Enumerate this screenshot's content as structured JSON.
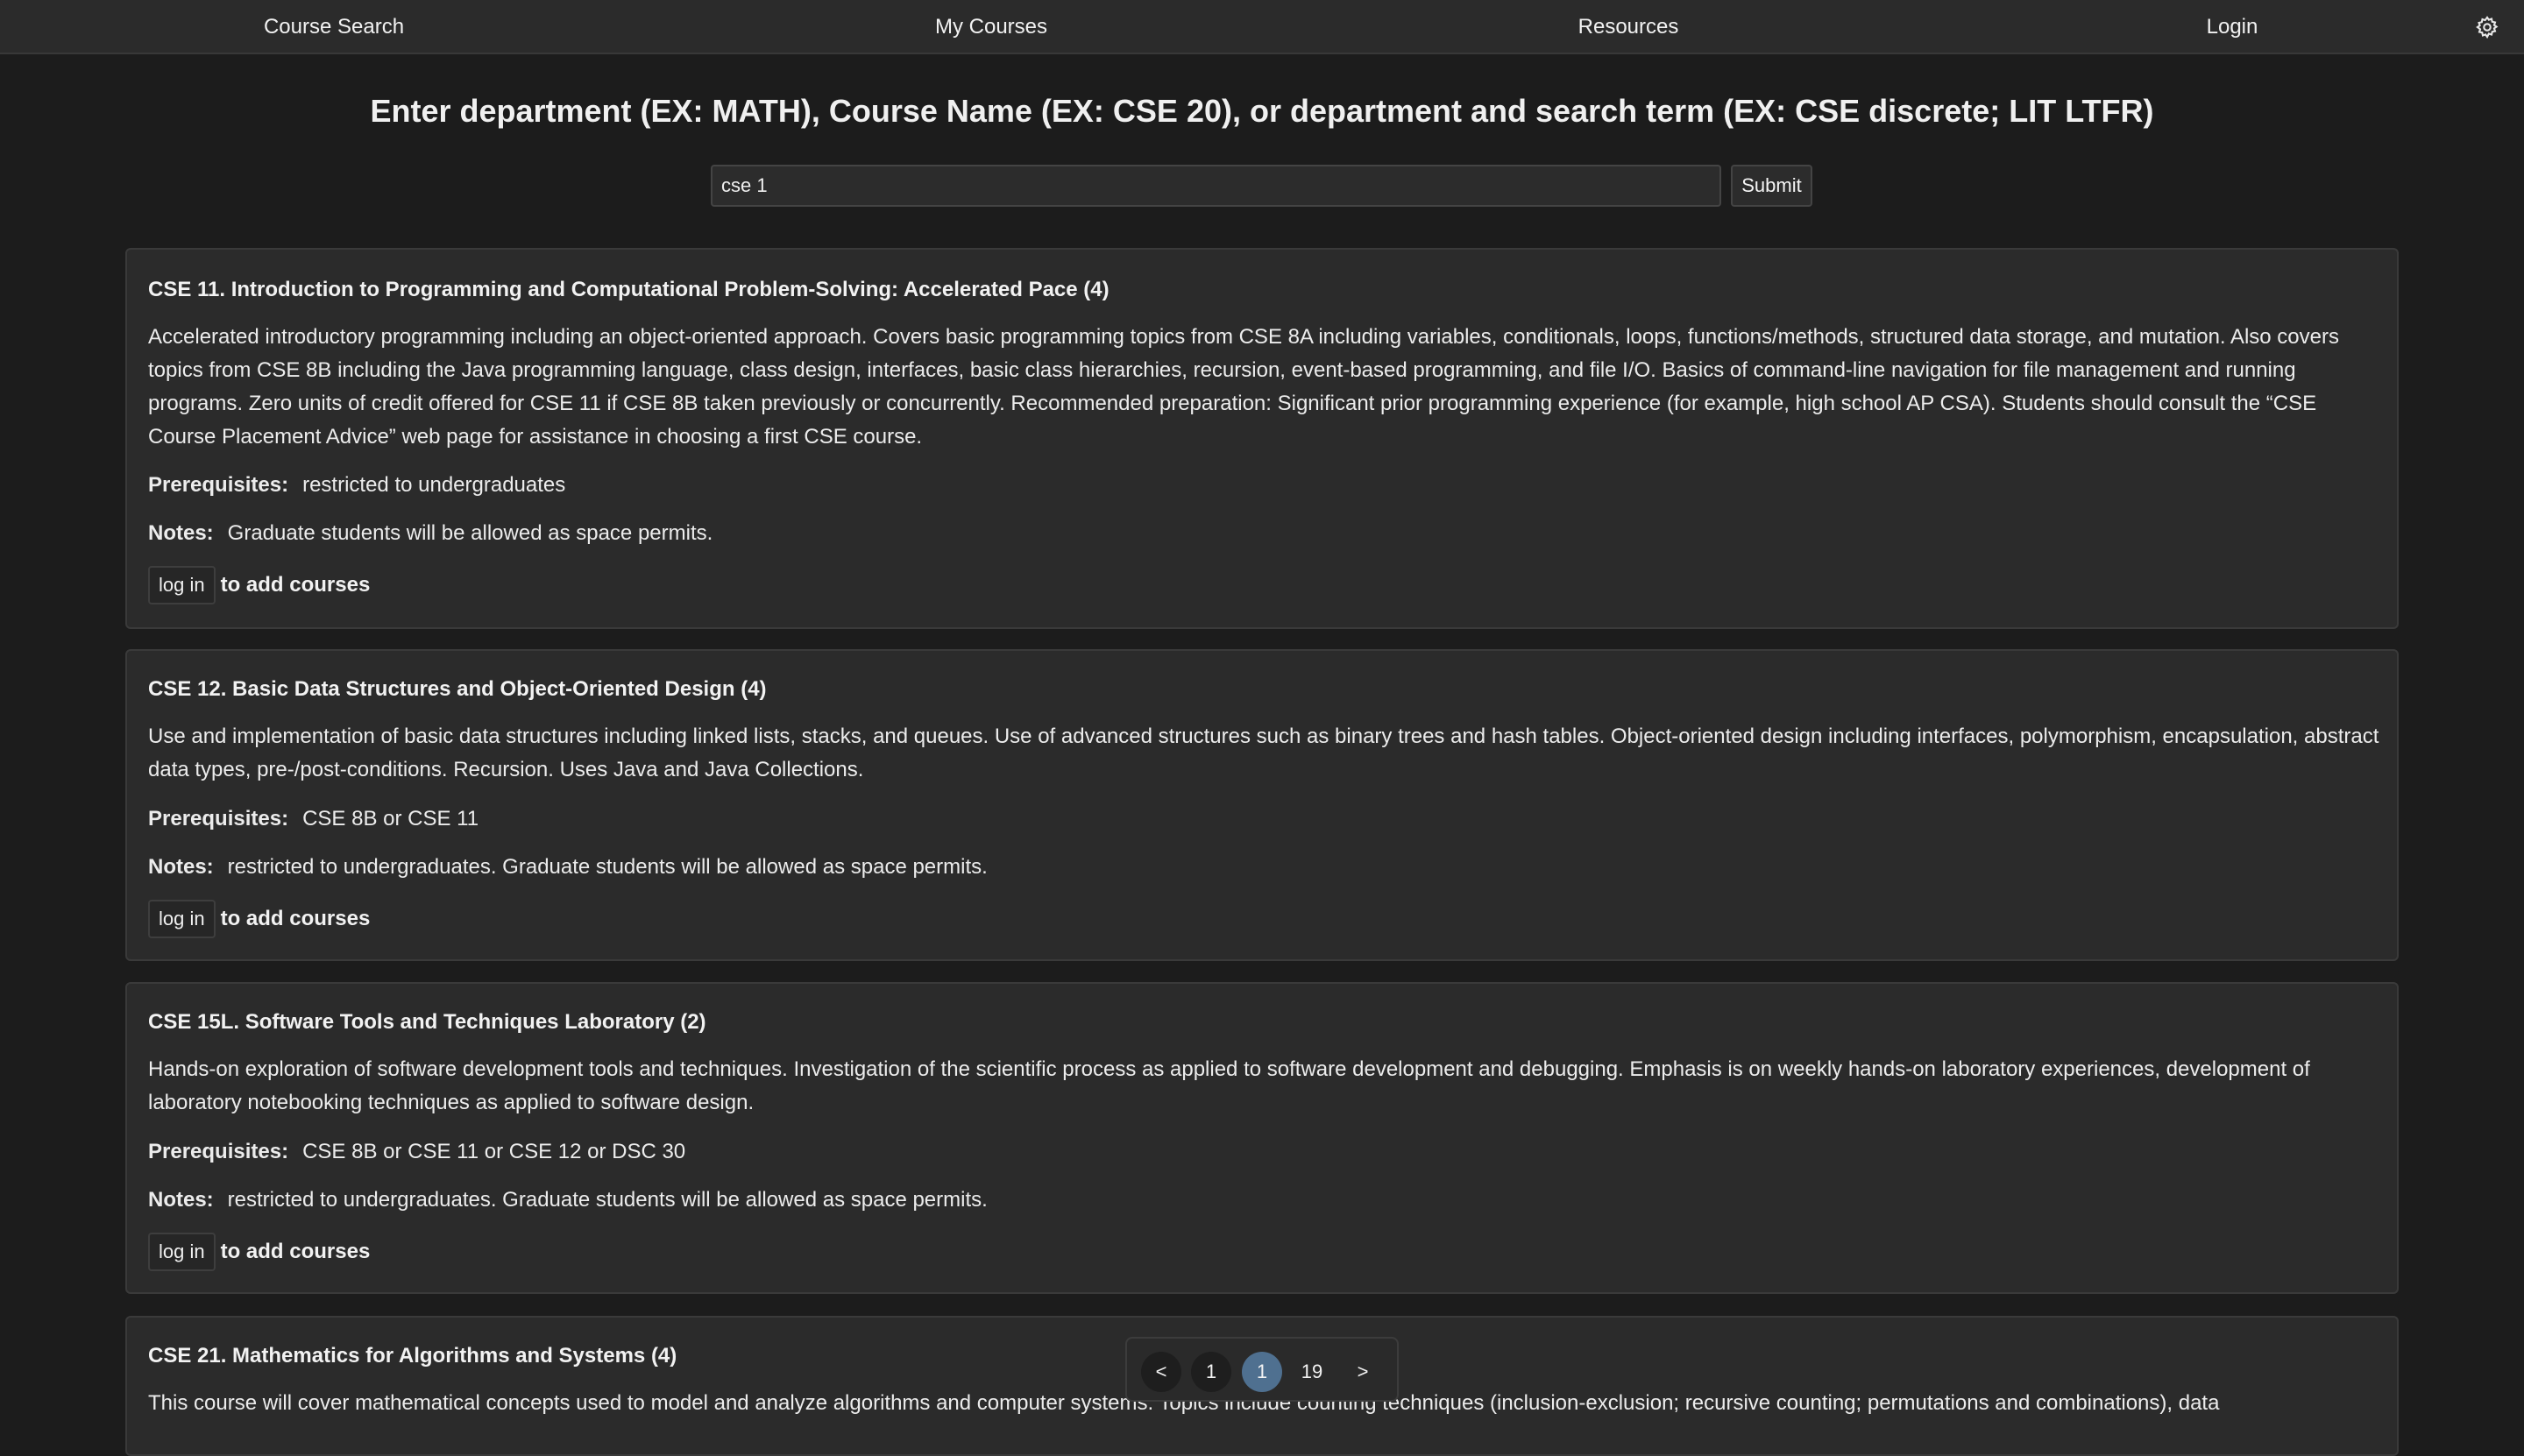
{
  "nav": {
    "course_search": "Course Search",
    "my_courses": "My Courses",
    "resources": "Resources",
    "login": "Login",
    "settings_icon": "gear-icon"
  },
  "search": {
    "heading": "Enter department (EX: MATH), Course Name (EX: CSE 20), or department and search term (EX: CSE discrete; LIT LTFR)",
    "value": "cse 1",
    "submit_label": "Submit"
  },
  "courses": [
    {
      "title": "CSE 11. Introduction to Programming and Computational Problem-Solving: Accelerated Pace (4)",
      "description": "Accelerated introductory programming including an object-oriented approach. Covers basic programming topics from CSE 8A including variables, conditionals, loops, functions/methods, structured data storage, and mutation. Also covers topics from CSE 8B including the Java programming language, class design, interfaces, basic class hierarchies, recursion, event-based programming, and file I/O. Basics of command-line navigation for file management and running programs. Zero units of credit offered for CSE 11 if CSE 8B taken previously or concurrently. Recommended preparation: Significant prior programming experience (for example, high school AP CSA). Students should consult the “CSE Course Placement Advice” web page for assistance in choosing a first CSE course.",
      "prereq_label": "Prerequisites:",
      "prereq": "restricted to undergraduates",
      "notes_label": "Notes:",
      "notes": "Graduate students will be allowed as space permits.",
      "login_label": "log in",
      "login_suffix": "to add courses"
    },
    {
      "title": "CSE 12. Basic Data Structures and Object-Oriented Design (4)",
      "description": "Use and implementation of basic data structures including linked lists, stacks, and queues. Use of advanced structures such as binary trees and hash tables. Object-oriented design including interfaces, polymorphism, encapsulation, abstract data types, pre-/post-conditions. Recursion. Uses Java and Java Collections.",
      "prereq_label": "Prerequisites:",
      "prereq": "CSE 8B or CSE 11",
      "notes_label": "Notes:",
      "notes": "restricted to undergraduates. Graduate students will be allowed as space permits.",
      "login_label": "log in",
      "login_suffix": "to add courses"
    },
    {
      "title": "CSE 15L. Software Tools and Techniques Laboratory (2)",
      "description": "Hands-on exploration of software development tools and techniques. Investigation of the scientific process as applied to software development and debugging. Emphasis is on weekly hands-on laboratory experiences, development of laboratory notebooking techniques as applied to software design.",
      "prereq_label": "Prerequisites:",
      "prereq": "CSE 8B or CSE 11 or CSE 12 or DSC 30",
      "notes_label": "Notes:",
      "notes": "restricted to undergraduates. Graduate students will be allowed as space permits.",
      "login_label": "log in",
      "login_suffix": "to add courses"
    },
    {
      "title": "CSE 21. Mathematics for Algorithms and Systems (4)",
      "description": "This course will cover mathematical concepts used to model and analyze algorithms and computer systems. Topics include counting techniques (inclusion-exclusion; recursive counting; permutations and combinations), data"
    }
  ],
  "pager": {
    "prev": "<",
    "first": "1",
    "current": "1",
    "last": "19",
    "next": ">"
  }
}
